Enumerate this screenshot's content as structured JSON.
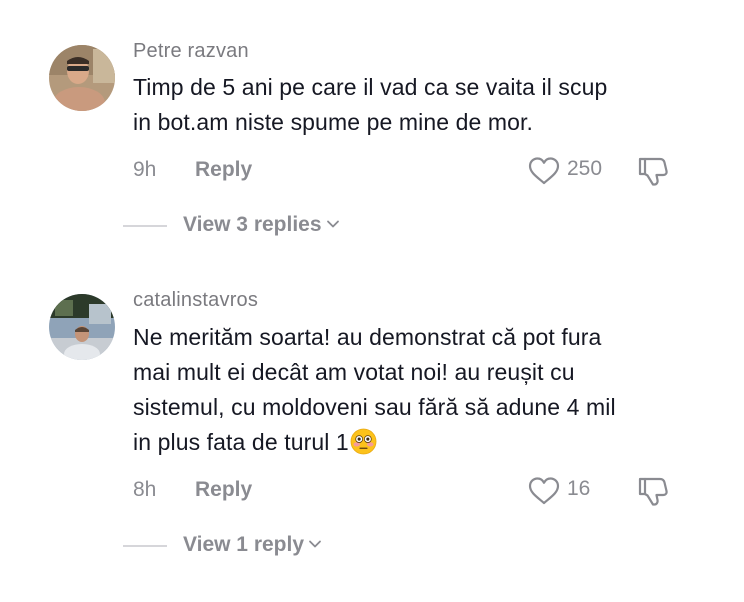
{
  "comments": [
    {
      "username": "Petre razvan",
      "text_lines": [
        "Timp de 5 ani pe care il vad ca se vaita il scup",
        "in bot.am niste spume pe mine de mor."
      ],
      "time": "9h",
      "reply_label": "Reply",
      "like_count": "250",
      "view_replies_label": "View 3 replies",
      "avatar_icon": "person-photo"
    },
    {
      "username": "catalinstavros",
      "text_lines": [
        "Ne merităm soarta! au demonstrat că pot fura",
        "mai mult ei decât am votat noi! au reușit cu",
        "sistemul, cu moldoveni sau fără să adune 4 mil",
        "in plus fata de turul 1"
      ],
      "emoji": "flushed-face-emoji",
      "time": "8h",
      "reply_label": "Reply",
      "like_count": "16",
      "view_replies_label": "View 1 reply",
      "avatar_icon": "person-photo"
    }
  ],
  "colors": {
    "text_primary": "#161823",
    "text_secondary": "#8a8b91",
    "divider": "#d6d6da"
  }
}
